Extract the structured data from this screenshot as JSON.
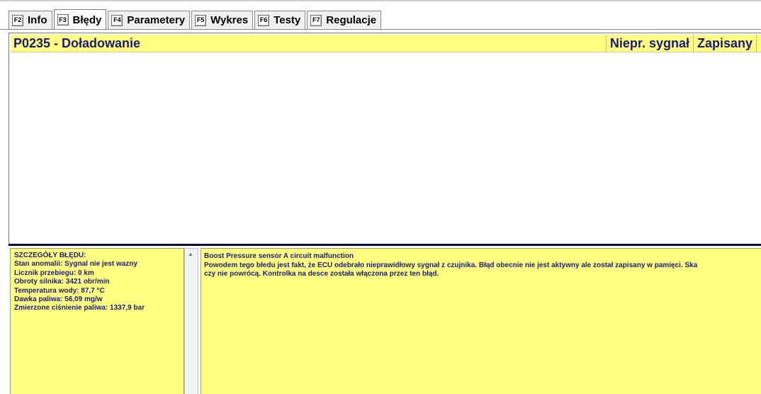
{
  "tabs": [
    {
      "key": "F2",
      "label": "Info",
      "active": false
    },
    {
      "key": "F3",
      "label": "Błędy",
      "active": true
    },
    {
      "key": "F4",
      "label": "Parametery",
      "active": false
    },
    {
      "key": "F5",
      "label": "Wykres",
      "active": false
    },
    {
      "key": "F6",
      "label": "Testy",
      "active": false
    },
    {
      "key": "F7",
      "label": "Regulacje",
      "active": false
    }
  ],
  "errors": {
    "row": {
      "code": "P0235 - Doładowanie",
      "signal": "Niepr. sygnał",
      "status": "Zapisany"
    }
  },
  "details": {
    "title": "SZCZEGÓŁY BŁĘDU:",
    "lines": [
      "Stan anomalii: Sygnal nie jest wazny",
      "Licznik przebiegu: 0 km",
      "Obroty silnika: 3421 obr/min",
      "Temperatura wody: 87,7 °C",
      "Dawka paliwa: 56,09 mg/w",
      "Zmierzone ciśnienie paliwa: 1337,9 bar"
    ]
  },
  "description": {
    "lines": [
      "Boost Pressure sensor A circuit malfunction",
      "Powodem tego błedu jest fakt, że ECU odebrało nieprawidłowy sygnał z czujnika. Błąd obecnie nie jest aktywny ale został zapisany w pamięci. Ska",
      "czy nie powrócą. Kontrolka na desce została włączona przez ten błąd."
    ]
  },
  "colors": {
    "panel_yellow": "#ffff80",
    "text_navy": "#1a1a7a"
  }
}
